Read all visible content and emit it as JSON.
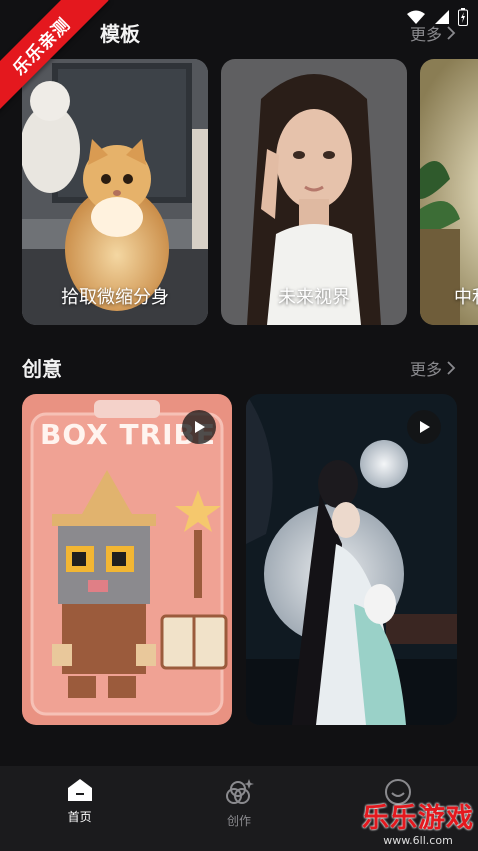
{
  "status_bar": {
    "icons": [
      "wifi-icon",
      "signal-icon",
      "battery-icon"
    ]
  },
  "ribbon": {
    "text": "乐乐亲测"
  },
  "templates_section": {
    "title": "模板",
    "more": "更多",
    "cards": [
      {
        "label": "拾取微缩分身"
      },
      {
        "label": "未来视界"
      },
      {
        "label": "中和"
      }
    ]
  },
  "creative_section": {
    "title": "创意",
    "more": "更多",
    "cards": [
      {
        "box_text": "BOX TRIBE",
        "icon": "play-icon"
      },
      {
        "icon": "play-icon"
      }
    ]
  },
  "bottom_nav": {
    "items": [
      {
        "label": "首页",
        "icon": "home-icon",
        "active": true
      },
      {
        "label": "创作",
        "icon": "create-icon",
        "active": false
      },
      {
        "label": "",
        "icon": "profile-icon",
        "active": false
      }
    ]
  },
  "watermark": {
    "title": "乐乐游戏",
    "url": "www.6ll.com"
  }
}
